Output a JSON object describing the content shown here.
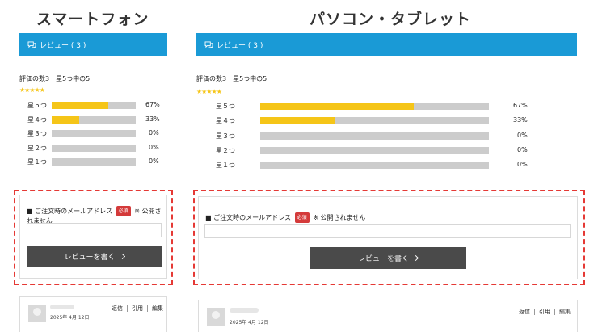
{
  "columns": {
    "mobile": {
      "title": "スマートフォン"
    },
    "desktop": {
      "title": "パソコン・タブレット"
    }
  },
  "reviews_header": {
    "label": "レビュー ( 3 )",
    "icon": "chat-bubbles-icon"
  },
  "summary": {
    "count_text": "評価の数3　星5つ中の5",
    "stars": "★★★★★"
  },
  "ratings": [
    {
      "label": "星５つ",
      "percent": 67,
      "percent_text": "67%"
    },
    {
      "label": "星４つ",
      "percent": 33,
      "percent_text": "33%"
    },
    {
      "label": "星３つ",
      "percent": 0,
      "percent_text": "0%"
    },
    {
      "label": "星２つ",
      "percent": 0,
      "percent_text": "0%"
    },
    {
      "label": "星１つ",
      "percent": 0,
      "percent_text": "0%"
    }
  ],
  "form": {
    "label": "■ ご注文時のメールアドレス",
    "required_badge": "必須",
    "note": "※ 公開されません",
    "button_label": "レビューを書く",
    "accent_color": "#e53935"
  },
  "review": {
    "date": "2025年 4月 12日",
    "actions": [
      "返信",
      "引用",
      "編集"
    ]
  },
  "colors": {
    "header": "#1a9ad6",
    "bar_fill": "#f5c518",
    "bar_track": "#cccccc",
    "button": "#4a4a4a"
  }
}
